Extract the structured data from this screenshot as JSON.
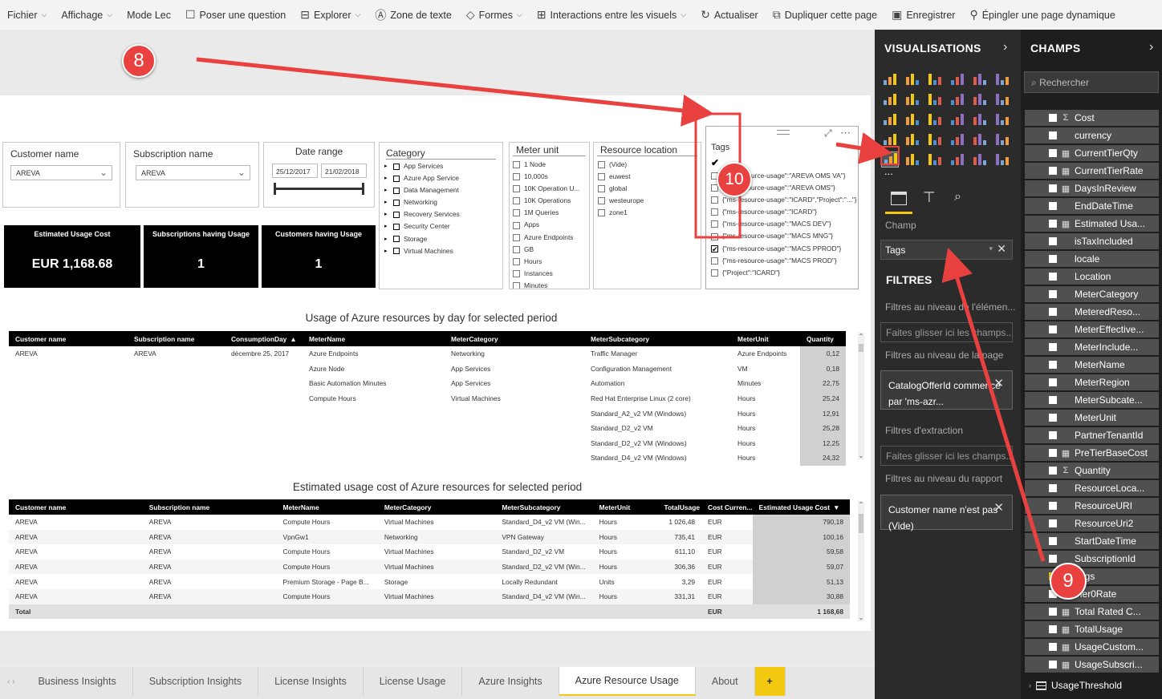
{
  "toolbar": [
    {
      "label": "Fichier",
      "icon": "",
      "caret": true
    },
    {
      "label": "Affichage",
      "icon": "",
      "caret": true
    },
    {
      "label": "Mode Lec",
      "icon": "",
      "caret": false
    },
    {
      "label": "Poser une question",
      "icon": "comment-icon",
      "caret": false
    },
    {
      "label": "Explorer",
      "icon": "explore-icon",
      "caret": true
    },
    {
      "label": "Zone de texte",
      "icon": "textbox-icon",
      "caret": false
    },
    {
      "label": "Formes",
      "icon": "shapes-icon",
      "caret": true
    },
    {
      "label": "Interactions entre les visuels",
      "icon": "interactions-icon",
      "caret": true
    },
    {
      "label": "Actualiser",
      "icon": "refresh-icon",
      "caret": false
    },
    {
      "label": "Dupliquer cette page",
      "icon": "duplicate-icon",
      "caret": false
    },
    {
      "label": "Enregistrer",
      "icon": "save-icon",
      "caret": false
    },
    {
      "label": "Épingler une page dynamique",
      "icon": "pin-icon",
      "caret": false
    }
  ],
  "slicers": {
    "customer": {
      "title": "Customer name",
      "value": "AREVA"
    },
    "subscription": {
      "title": "Subscription name",
      "value": "AREVA"
    },
    "date": {
      "title": "Date range",
      "from": "25/12/2017",
      "to": "21/02/2018"
    },
    "category": {
      "title": "Category",
      "items": [
        "App Services",
        "Azure App Service",
        "Data Management",
        "Networking",
        "Recovery Services",
        "Security Center",
        "Storage",
        "Virtual Machines"
      ]
    },
    "meter_unit": {
      "title": "Meter unit",
      "items": [
        "1 Node",
        "10,000s",
        "10K Operation U...",
        "10K Operations",
        "1M Queries",
        "Apps",
        "Azure Endpoints",
        "GB",
        "Hours",
        "Instances",
        "Minutes"
      ]
    },
    "resource_location": {
      "title": "Resource location",
      "items": [
        "(Vide)",
        "euwest",
        "global",
        "westeurope",
        "zone1"
      ]
    },
    "tags": {
      "title": "Tags",
      "items": [
        {
          "label": "{\"ms-resource-usage\":\"AREVA OMS VA\"}",
          "checked": false
        },
        {
          "label": "{\"ms-resource-usage\":\"AREVA OMS\"}",
          "checked": false
        },
        {
          "label": "{\"ms-resource-usage\":\"ICARD\",\"Project\":\"...\"}",
          "checked": false
        },
        {
          "label": "{\"ms-resource-usage\":\"ICARD\"}",
          "checked": false
        },
        {
          "label": "{\"ms-resource-usage\":\"MACS DEV\"}",
          "checked": false
        },
        {
          "label": "{\"ms-resource-usage\":\"MACS MNG\"}",
          "checked": false
        },
        {
          "label": "{\"ms-resource-usage\":\"MACS PPROD\"}",
          "checked": true
        },
        {
          "label": "{\"ms-resource-usage\":\"MACS PROD\"}",
          "checked": false
        },
        {
          "label": "{\"Project\":\"ICARD\"}",
          "checked": false
        }
      ]
    }
  },
  "cards": [
    {
      "title": "Estimated Usage Cost",
      "value": "EUR 1,168.68"
    },
    {
      "title": "Subscriptions having Usage",
      "value": "1"
    },
    {
      "title": "Customers having Usage",
      "value": "1"
    }
  ],
  "table1": {
    "title": "Usage of Azure resources by day for selected period",
    "columns": [
      "Customer name",
      "Subscription name",
      "ConsumptionDay",
      "MeterName",
      "MeterCategory",
      "MeterSubcategory",
      "MeterUnit",
      "Quantity"
    ],
    "sort_indicator": "▲",
    "rows": [
      [
        "AREVA",
        "AREVA",
        "décembre 25, 2017",
        "Azure Endpoints",
        "Networking",
        "Traffic Manager",
        "Azure Endpoints",
        "0,12"
      ],
      [
        "",
        "",
        "",
        "Azure Node",
        "App Services",
        "Configuration Management",
        "VM",
        "0,18"
      ],
      [
        "",
        "",
        "",
        "Basic Automation Minutes",
        "App Services",
        "Automation",
        "Minutes",
        "22,75"
      ],
      [
        "",
        "",
        "",
        "Compute Hours",
        "Virtual Machines",
        "Red Hat Enterprise Linux (2 core)",
        "Hours",
        "25,24"
      ],
      [
        "",
        "",
        "",
        "",
        "",
        "Standard_A2_v2 VM (Windows)",
        "Hours",
        "12,91"
      ],
      [
        "",
        "",
        "",
        "",
        "",
        "Standard_D2_v2 VM",
        "Hours",
        "25,28"
      ],
      [
        "",
        "",
        "",
        "",
        "",
        "Standard_D2_v2 VM (Windows)",
        "Hours",
        "12,25"
      ],
      [
        "",
        "",
        "",
        "",
        "",
        "Standard_D4_v2 VM (Windows)",
        "Hours",
        "24,32"
      ]
    ]
  },
  "table2": {
    "title": "Estimated usage cost of Azure resources for selected period",
    "columns": [
      "Customer name",
      "Subscription name",
      "MeterName",
      "MeterCategory",
      "MeterSubcategory",
      "MeterUnit",
      "TotalUsage",
      "Cost Curren...",
      "Estimated Usage Cost"
    ],
    "sort_indicator": "▼",
    "rows": [
      [
        "AREVA",
        "AREVA",
        "Compute Hours",
        "Virtual Machines",
        "Standard_D4_v2 VM (Win...",
        "Hours",
        "1 026,48",
        "EUR",
        "790,18"
      ],
      [
        "AREVA",
        "AREVA",
        "VpnGw1",
        "Networking",
        "VPN Gateway",
        "Hours",
        "735,41",
        "EUR",
        "100,16"
      ],
      [
        "AREVA",
        "AREVA",
        "Compute Hours",
        "Virtual Machines",
        "Standard_D2_v2 VM",
        "Hours",
        "611,10",
        "EUR",
        "59,58"
      ],
      [
        "AREVA",
        "AREVA",
        "Compute Hours",
        "Virtual Machines",
        "Standard_D2_v2 VM (Win...",
        "Hours",
        "306,36",
        "EUR",
        "59,07"
      ],
      [
        "AREVA",
        "AREVA",
        "Premium Storage - Page B...",
        "Storage",
        "Locally Redundant",
        "Units",
        "3,29",
        "EUR",
        "51,13"
      ],
      [
        "AREVA",
        "AREVA",
        "Compute Hours",
        "Virtual Machines",
        "Standard_D4_v2 VM (Win...",
        "Hours",
        "331,31",
        "EUR",
        "30,88"
      ]
    ],
    "total": [
      "Total",
      "",
      "",
      "",
      "",
      "",
      "",
      "EUR",
      "1 168,68"
    ]
  },
  "tabs": [
    "Business Insights",
    "Subscription Insights",
    "License Insights",
    "License Usage",
    "Azure Insights",
    "Azure Resource Usage",
    "About",
    "+"
  ],
  "active_tab": "Azure Resource Usage",
  "viz_pane": {
    "title": "VISUALISATIONS",
    "more": "...",
    "champ_label": "Champ",
    "champ_value": "Tags",
    "filters_title": "FILTRES",
    "filter_visual_level": "Filtres au niveau de l'élémen...",
    "drop_here_1": "Faites glisser ici les champs...",
    "filter_page_level": "Filtres au niveau de la page",
    "page_filter": "CatalogOfferId commence par 'ms-azr...",
    "filter_drillthrough": "Filtres d'extraction",
    "drop_here_2": "Faites glisser ici les champs...",
    "filter_report_level": "Filtres au niveau du rapport",
    "report_filter": "Customer name n'est pas (Vide)"
  },
  "fields_pane": {
    "title": "CHAMPS",
    "search_placeholder": "Rechercher",
    "items": [
      {
        "label": "Cost",
        "sigma": true,
        "on": false
      },
      {
        "label": "currency",
        "sigma": false,
        "on": false
      },
      {
        "label": "CurrentTierQty",
        "sigma": "calc",
        "on": false
      },
      {
        "label": "CurrentTierRate",
        "sigma": "calc",
        "on": false
      },
      {
        "label": "DaysInReview",
        "sigma": "calc",
        "on": false
      },
      {
        "label": "EndDateTime",
        "sigma": false,
        "on": false
      },
      {
        "label": "Estimated Usa...",
        "sigma": "calc",
        "on": false
      },
      {
        "label": "isTaxIncluded",
        "sigma": false,
        "on": false
      },
      {
        "label": "locale",
        "sigma": false,
        "on": false
      },
      {
        "label": "Location",
        "sigma": false,
        "on": false
      },
      {
        "label": "MeterCategory",
        "sigma": false,
        "on": false
      },
      {
        "label": "MeteredReso...",
        "sigma": false,
        "on": false
      },
      {
        "label": "MeterEffective...",
        "sigma": false,
        "on": false
      },
      {
        "label": "MeterInclude...",
        "sigma": false,
        "on": false
      },
      {
        "label": "MeterName",
        "sigma": false,
        "on": false
      },
      {
        "label": "MeterRegion",
        "sigma": false,
        "on": false
      },
      {
        "label": "MeterSubcate...",
        "sigma": false,
        "on": false
      },
      {
        "label": "MeterUnit",
        "sigma": false,
        "on": false
      },
      {
        "label": "PartnerTenantId",
        "sigma": false,
        "on": false
      },
      {
        "label": "PreTierBaseCost",
        "sigma": "calc",
        "on": false
      },
      {
        "label": "Quantity",
        "sigma": true,
        "on": false
      },
      {
        "label": "ResourceLoca...",
        "sigma": false,
        "on": false
      },
      {
        "label": "ResourceURI",
        "sigma": false,
        "on": false
      },
      {
        "label": "ResourceUri2",
        "sigma": false,
        "on": false
      },
      {
        "label": "StartDateTime",
        "sigma": false,
        "on": false
      },
      {
        "label": "SubscriptionId",
        "sigma": false,
        "on": false
      },
      {
        "label": "Tags",
        "sigma": false,
        "on": true
      },
      {
        "label": "Tier0Rate",
        "sigma": "calc",
        "on": false
      },
      {
        "label": "Total Rated C...",
        "sigma": "calc",
        "on": false
      },
      {
        "label": "TotalUsage",
        "sigma": "calc",
        "on": false
      },
      {
        "label": "UsageCustom...",
        "sigma": "calc",
        "on": false
      },
      {
        "label": "UsageSubscri...",
        "sigma": "calc",
        "on": false
      }
    ],
    "next_table": "UsageThreshold"
  },
  "annotations": [
    "8",
    "9",
    "10"
  ],
  "colors": {
    "accent": "#f2c811",
    "annotation": "#e8413f",
    "pane_dark": "#2b2b2b"
  }
}
